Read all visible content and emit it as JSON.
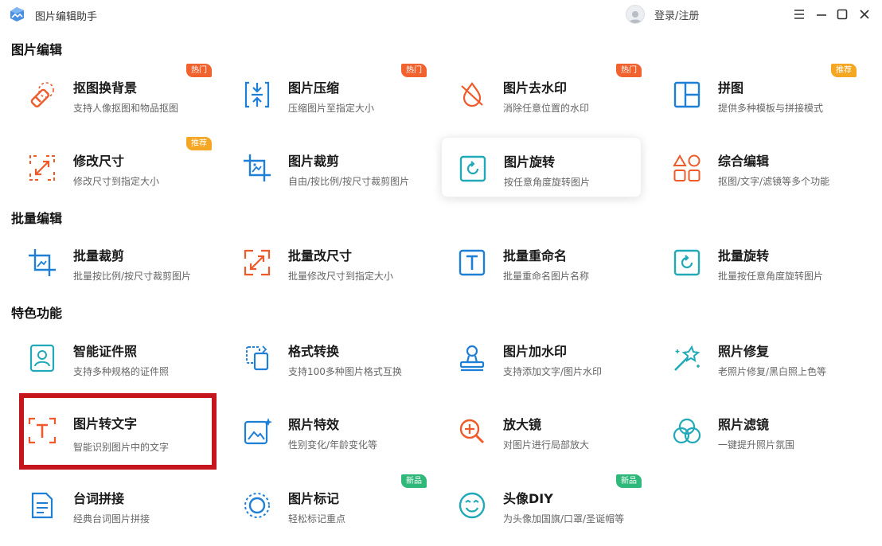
{
  "window": {
    "title": "图片编辑助手",
    "login_label": "登录/注册"
  },
  "colors": {
    "blue_icon": "#1e7fd6",
    "orange_icon": "#ef5a2a",
    "teal_icon": "#21a9b8",
    "highlight": "#c4161c"
  },
  "sections": {
    "image_edit": "图片编辑",
    "batch_edit": "批量编辑",
    "features": "特色功能"
  },
  "cards": {
    "cutout": {
      "name": "抠图换背景",
      "desc": "支持人像抠图和物品抠图",
      "badge": "热门",
      "icon": "eraser-icon"
    },
    "compress": {
      "name": "图片压缩",
      "desc": "压缩图片至指定大小",
      "badge": "热门",
      "icon": "compress-icon"
    },
    "watermark_rm": {
      "name": "图片去水印",
      "desc": "消除任意位置的水印",
      "badge": "热门",
      "icon": "drop-slash-icon"
    },
    "collage": {
      "name": "拼图",
      "desc": "提供多种模板与拼接模式",
      "badge": "推荐",
      "icon": "layout-icon"
    },
    "resize": {
      "name": "修改尺寸",
      "desc": "修改尺寸到指定大小",
      "badge": "推荐",
      "icon": "resize-arrows-icon"
    },
    "crop": {
      "name": "图片裁剪",
      "desc": "自由/按比例/按尺寸裁剪图片",
      "badge": "",
      "icon": "crop-icon"
    },
    "rotate": {
      "name": "图片旋转",
      "desc": "按任意角度旋转图片",
      "badge": "",
      "icon": "rotate-icon"
    },
    "combo": {
      "name": "综合编辑",
      "desc": "抠图/文字/滤镜等多个功能",
      "badge": "",
      "icon": "shapes-icon"
    },
    "batch_crop": {
      "name": "批量裁剪",
      "desc": "批量按比例/按尺寸裁剪图片",
      "badge": "",
      "icon": "crop-icon"
    },
    "batch_resize": {
      "name": "批量改尺寸",
      "desc": "批量修改尺寸到指定大小",
      "badge": "",
      "icon": "resize-arrows-icon"
    },
    "batch_rename": {
      "name": "批量重命名",
      "desc": "批量重命名图片名称",
      "badge": "",
      "icon": "text-box-icon"
    },
    "batch_rotate": {
      "name": "批量旋转",
      "desc": "批量按任意角度旋转图片",
      "badge": "",
      "icon": "rotate-icon"
    },
    "id_photo": {
      "name": "智能证件照",
      "desc": "支持多种规格的证件照",
      "badge": "",
      "icon": "id-photo-icon"
    },
    "convert": {
      "name": "格式转换",
      "desc": "支持100多种图片格式互换",
      "badge": "",
      "icon": "convert-icon"
    },
    "add_wm": {
      "name": "图片加水印",
      "desc": "支持添加文字/图片水印",
      "badge": "",
      "icon": "stamp-icon"
    },
    "repair": {
      "name": "照片修复",
      "desc": "老照片修复/黑白照上色等",
      "badge": "",
      "icon": "magic-wand-icon"
    },
    "ocr": {
      "name": "图片转文字",
      "desc": "智能识别图片中的文字",
      "badge": "",
      "icon": "ocr-icon"
    },
    "effects": {
      "name": "照片特效",
      "desc": "性别变化/年龄变化等",
      "badge": "",
      "icon": "image-sparkle-icon"
    },
    "magnifier": {
      "name": "放大镜",
      "desc": "对图片进行局部放大",
      "badge": "",
      "icon": "zoom-in-icon"
    },
    "filter": {
      "name": "照片滤镜",
      "desc": "一键提升照片氛围",
      "badge": "",
      "icon": "filter-circles-icon"
    },
    "teleprompter": {
      "name": "台词拼接",
      "desc": "经典台词图片拼接",
      "badge": "",
      "icon": "document-icon"
    },
    "mark": {
      "name": "图片标记",
      "desc": "轻松标记重点",
      "badge": "新品",
      "icon": "target-icon"
    },
    "avatar": {
      "name": "头像DIY",
      "desc": "为头像加国旗/口罩/圣诞帽等",
      "badge": "新品",
      "icon": "smiley-icon"
    }
  }
}
